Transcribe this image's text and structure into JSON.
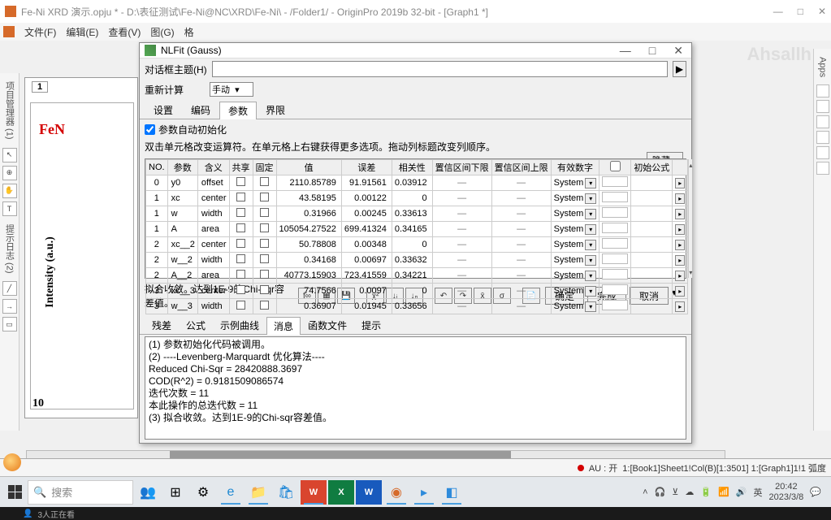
{
  "main_title": "Fe-Ni XRD 演示.opju * - D:\\表征测试\\Fe-Ni@NC\\XRD\\Fe-Ni\\ - /Folder1/ - OriginPro 2019b 32-bit - [Graph1 *]",
  "menu": [
    "文件(F)",
    "编辑(E)",
    "查看(V)",
    "图(G)",
    "格"
  ],
  "graph": {
    "tab": "1",
    "fen": "FeN",
    "yaxis": "Intensity (a.u.)",
    "xnum": "10"
  },
  "dialog": {
    "title": "NLFit (Gauss)",
    "theme_label": "对话框主题(H)",
    "recalc_label": "重新计算",
    "recalc_value": "手动",
    "top_tabs": [
      "设置",
      "编码",
      "参数",
      "界限"
    ],
    "active_top_tab": 2,
    "auto_init": "参数自动初始化",
    "hint": "双击单元格改变运算符。在单元格上右键获得更多选项。拖动列标题改变列顺序。",
    "hide": "隐藏...",
    "headers": [
      "NO.",
      "参数",
      "含义",
      "共享",
      "固定",
      "值",
      "误差",
      "相关性",
      "置信区间下限",
      "置信区间上限",
      "有效数字",
      "",
      "初始公式",
      ""
    ],
    "init_formula": "初始公式",
    "rows": [
      {
        "no": "0",
        "p": "y0",
        "m": "offset",
        "v": "2110.85789",
        "e": "91.91561",
        "d": "0.03912",
        "sys": "System"
      },
      {
        "no": "1",
        "p": "xc",
        "m": "center",
        "v": "43.58195",
        "e": "0.00122",
        "d": "0",
        "sys": "System"
      },
      {
        "no": "1",
        "p": "w",
        "m": "width",
        "v": "0.31966",
        "e": "0.00245",
        "d": "0.33613",
        "sys": "System"
      },
      {
        "no": "1",
        "p": "A",
        "m": "area",
        "v": "105054.27522",
        "e": "699.41324",
        "d": "0.34165",
        "sys": "System"
      },
      {
        "no": "2",
        "p": "xc__2",
        "m": "center",
        "v": "50.78808",
        "e": "0.00348",
        "d": "0",
        "sys": "System"
      },
      {
        "no": "2",
        "p": "w__2",
        "m": "width",
        "v": "0.34168",
        "e": "0.00697",
        "d": "0.33632",
        "sys": "System"
      },
      {
        "no": "2",
        "p": "A__2",
        "m": "area",
        "v": "40773.15903",
        "e": "723.41559",
        "d": "0.34221",
        "sys": "System"
      },
      {
        "no": "3",
        "p": "xc__3",
        "m": "center",
        "v": "74.7566",
        "e": "0.0097",
        "d": "0",
        "sys": "System"
      },
      {
        "no": "3",
        "p": "w__3",
        "m": "width",
        "v": "0.36907",
        "e": "0.01945",
        "d": "0.33656",
        "sys": "System"
      }
    ],
    "status_text": "拟合收敛。达到1E-9的Chi-sqr容差值。",
    "ok": "确定",
    "done": "完成",
    "cancel": "取消",
    "lower_tabs": [
      "残差",
      "公式",
      "示例曲线",
      "消息",
      "函数文件",
      "提示"
    ],
    "active_lower_tab": 3,
    "messages": [
      "(1) 参数初始化代码被调用。",
      "(2) ----Levenberg-Marquardt 优化算法----",
      "Reduced Chi-Sqr = 28420888.3697",
      "COD(R^2) = 0.9181509086574",
      "迭代次数 = 11",
      "本此操作的总迭代数 = 11",
      "(3) 拟合收敛。达到1E-9的Chi-sqr容差值。"
    ]
  },
  "status_bar": {
    "au": "AU : 开",
    "info": "1:[Book1]Sheet1!Col(B)[1:3501]  1:[Graph1]1!1 弧度"
  },
  "taskbar": {
    "search": "搜索",
    "ime": "英",
    "time": "20:42",
    "date": "2023/3/8"
  },
  "blackbar": "3人正在看",
  "watermark": "Ahsallh"
}
